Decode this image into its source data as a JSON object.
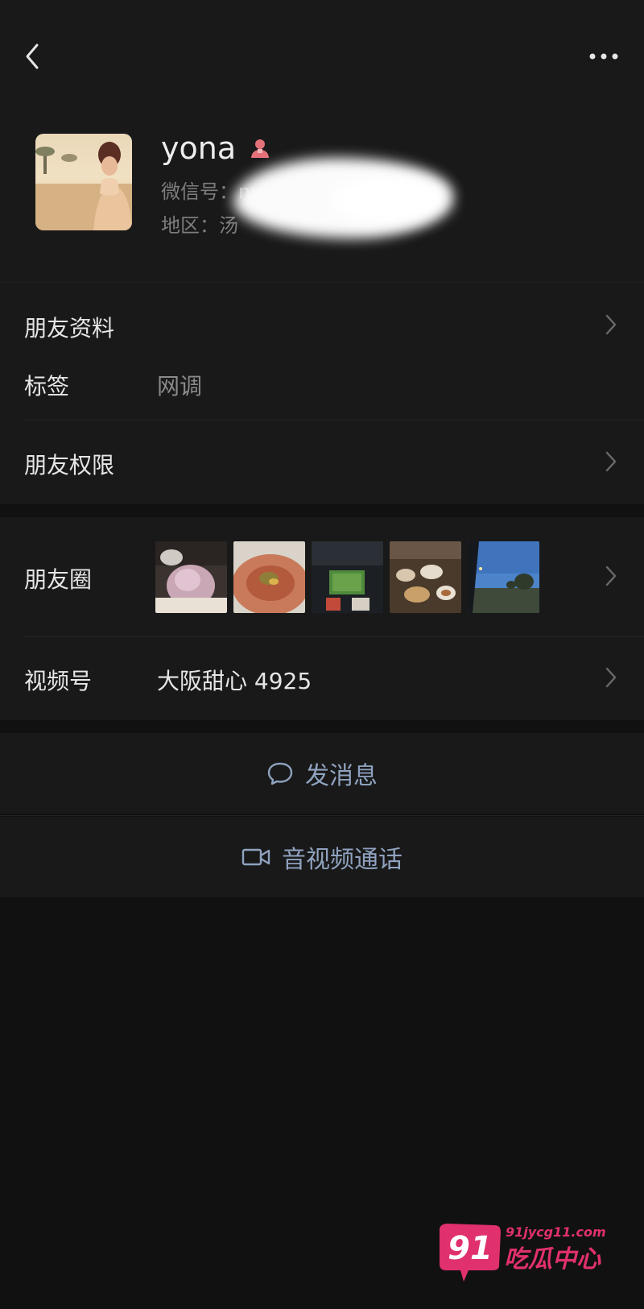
{
  "header": {
    "back_icon": "chevron-left-icon",
    "more_icon": "ellipsis-icon"
  },
  "profile": {
    "name": "yona",
    "gender_icon": "female-user-icon",
    "wechat_id_label": "微信号：nvidHay",
    "region_label": "地区：汤"
  },
  "info": {
    "friend_profile_label": "朋友资料",
    "tags_label": "标签",
    "tags_value": "网调",
    "permissions_label": "朋友权限"
  },
  "moments": {
    "label": "朋友圈",
    "thumbnails": [
      "flower-table",
      "soup-dish",
      "car-dashboard",
      "dining-table",
      "road-evening"
    ]
  },
  "channels": {
    "label": "视频号",
    "value": "大阪甜心 4925"
  },
  "actions": {
    "message_label": "发消息",
    "message_icon": "chat-bubble-icon",
    "call_label": "音视频通话",
    "call_icon": "video-camera-icon"
  },
  "watermark": {
    "number": "91",
    "url": "91jycg11.com",
    "text": "吃瓜中心"
  },
  "colors": {
    "background": "#111111",
    "panel": "#191919",
    "link": "#8fa2bf",
    "accent": "#e0306d"
  }
}
